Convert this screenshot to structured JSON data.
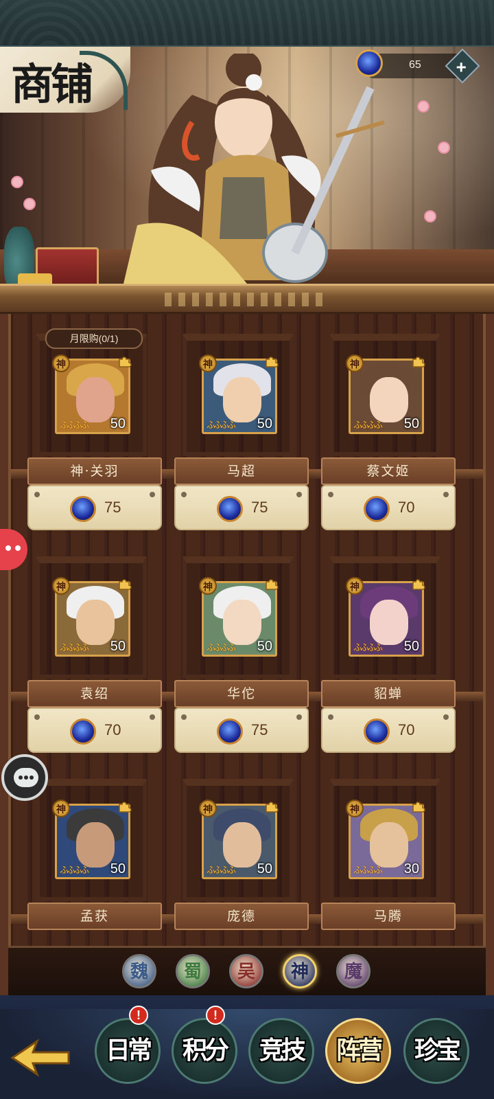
{
  "header": {
    "title": "商铺"
  },
  "currency": {
    "amount": "65",
    "icon": "gem-icon",
    "add": "+"
  },
  "shop": {
    "items": [
      {
        "name": "神·关羽",
        "badge": "神",
        "stars": "ふふふふ",
        "count": "50",
        "price": "75",
        "limit": "月限购(0/1)",
        "colors": {
          "bg": "#b5782f",
          "hair": "#d9a64a",
          "face": "#e0a48c"
        }
      },
      {
        "name": "马超",
        "badge": "神",
        "stars": "ふふふふ",
        "count": "50",
        "price": "75",
        "colors": {
          "bg": "#3c5a7a",
          "hair": "#e2e2ea",
          "face": "#f0cfae"
        }
      },
      {
        "name": "蔡文姬",
        "badge": "神",
        "stars": "ふふふふ",
        "count": "50",
        "price": "70",
        "colors": {
          "bg": "#6b4a36",
          "hair": "#6a4a34",
          "face": "#f3d4bd"
        }
      },
      {
        "name": "袁绍",
        "badge": "神",
        "stars": "ふふふふ",
        "count": "50",
        "price": "70",
        "colors": {
          "bg": "#8b6a3a",
          "hair": "#efefef",
          "face": "#e8c39c"
        }
      },
      {
        "name": "华佗",
        "badge": "神",
        "stars": "ふふふふ",
        "count": "50",
        "price": "75",
        "colors": {
          "bg": "#6a8a6a",
          "hair": "#efefef",
          "face": "#f3d9c2"
        }
      },
      {
        "name": "貂蝉",
        "badge": "神",
        "stars": "ふふふふ",
        "count": "50",
        "price": "70",
        "colors": {
          "bg": "#5a3a6a",
          "hair": "#6b3b7a",
          "face": "#f2d2cb"
        }
      },
      {
        "name": "孟获",
        "badge": "神",
        "stars": "ふふふふ",
        "count": "50",
        "price": "",
        "colors": {
          "bg": "#2f4a7a",
          "hair": "#3b3b3b",
          "face": "#c79a7a"
        }
      },
      {
        "name": "庞德",
        "badge": "神",
        "stars": "ふふふふ",
        "count": "50",
        "price": "",
        "colors": {
          "bg": "#4a5a6a",
          "hair": "#3e4b6b",
          "face": "#e2bd9c"
        }
      },
      {
        "name": "马腾",
        "badge": "神",
        "stars": "ふふふふ",
        "count": "30",
        "price": "",
        "colors": {
          "bg": "#7a6a9a",
          "hair": "#c9a04a",
          "face": "#e6c29c"
        }
      }
    ]
  },
  "factions": [
    {
      "label": "魏",
      "color": "#3a5a8a",
      "active": false
    },
    {
      "label": "蜀",
      "color": "#3d7a3d",
      "active": false
    },
    {
      "label": "吴",
      "color": "#8a2e2a",
      "active": false
    },
    {
      "label": "神",
      "color": "#1f2a5a",
      "active": true
    },
    {
      "label": "魔",
      "color": "#5a3a6a",
      "active": false
    }
  ],
  "nav": [
    {
      "label": "日常",
      "alert": "!",
      "active": false
    },
    {
      "label": "积分",
      "alert": "!",
      "active": false
    },
    {
      "label": "竞技",
      "alert": "",
      "active": false
    },
    {
      "label": "阵营",
      "alert": "",
      "active": true
    },
    {
      "label": "珍宝",
      "alert": "",
      "active": false
    }
  ],
  "colors": {
    "accent": "#d7a24a",
    "wood": "#5c3424",
    "parchment": "#f1e6c6"
  }
}
